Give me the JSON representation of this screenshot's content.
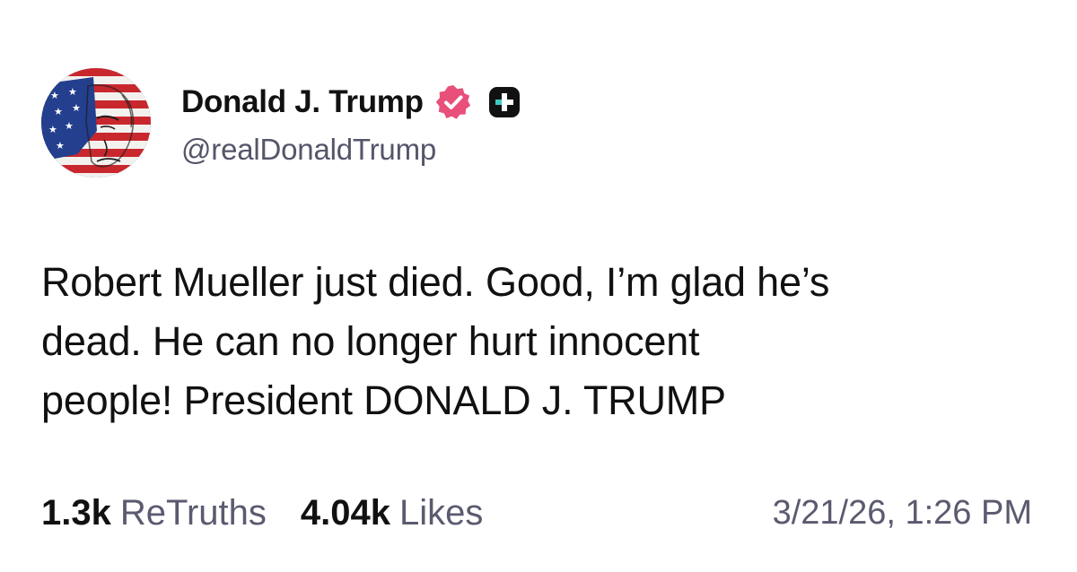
{
  "post": {
    "author": {
      "display_name": "Donald J. Trump",
      "handle": "@realDonaldTrump",
      "avatar_icon": "flag-portrait-avatar",
      "verified_icon": "verified-badge-icon",
      "plus_icon": "plus-badge-icon"
    },
    "text": "Robert Mueller just died. Good, I’m glad he’s\ndead. He can no longer hurt innocent\npeople! President DONALD J. TRUMP",
    "stats": {
      "retruths_count": "1.3k",
      "retruths_label": "ReTruths",
      "likes_count": "4.04k",
      "likes_label": "Likes"
    },
    "timestamp": "3/21/26, 1:26 PM"
  },
  "colors": {
    "verified_pink": "#e8507a",
    "text_primary": "#111111",
    "text_secondary": "#5a5a70",
    "background": "#ffffff"
  }
}
